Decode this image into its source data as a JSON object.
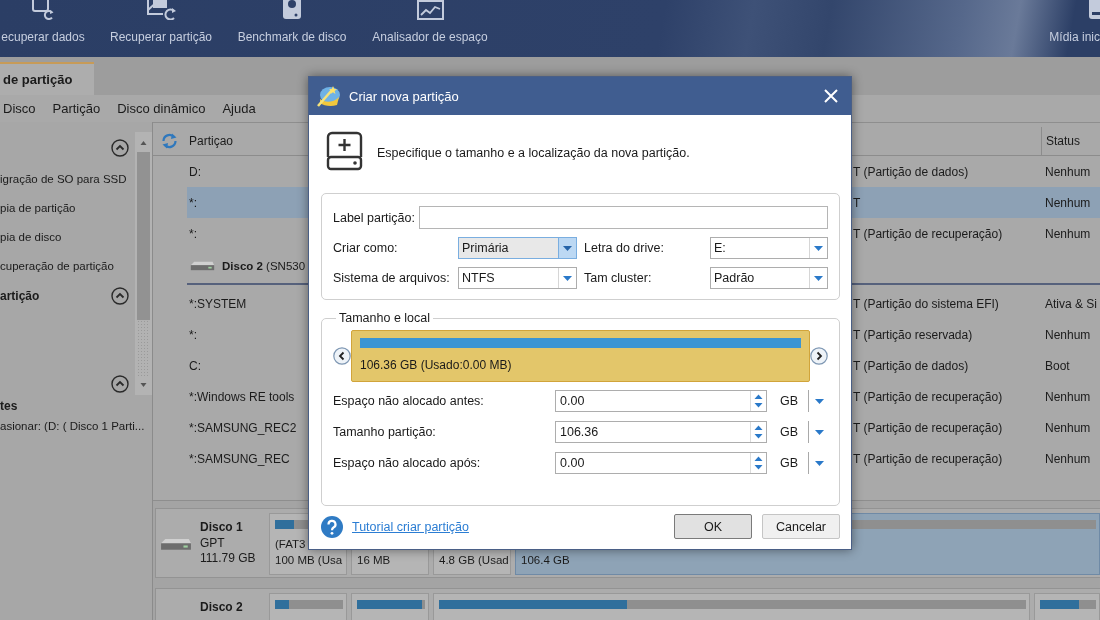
{
  "toolbar": {
    "items": [
      {
        "label": "ecuperar dados"
      },
      {
        "label": "Recuperar partição"
      },
      {
        "label": "Benchmark de disco"
      },
      {
        "label": "Analisador de espaço"
      },
      {
        "label": "Mídia inic"
      }
    ]
  },
  "tabs": [
    {
      "label": "de partição",
      "selected": true
    }
  ],
  "menu": [
    {
      "label": "Disco"
    },
    {
      "label": "Partição"
    },
    {
      "label": "Disco dinâmico"
    },
    {
      "label": "Ajuda"
    }
  ],
  "sidebar": {
    "sections": [
      {
        "expanded": true,
        "items": [
          "igração de SO para SSD",
          "pia de partição",
          "pia de disco",
          "cuperação de partição"
        ]
      },
      {
        "title": "artição",
        "expanded": true
      },
      {
        "expanded": true
      }
    ],
    "pending": {
      "title": "tes",
      "items": [
        "asionar: (D: ( Disco 1 Parti..."
      ]
    }
  },
  "table": {
    "columns": [
      {
        "label": "Partiçao"
      },
      {
        "label": "Status"
      }
    ],
    "rows": [
      {
        "kind": "partition",
        "name": "D:",
        "column_3": "T (Partição de dados)",
        "status": "Nenhum",
        "selected": false
      },
      {
        "kind": "partition",
        "name": "*:",
        "column_3": "T",
        "status": "Nenhum",
        "selected": true
      },
      {
        "kind": "partition",
        "name": "*:",
        "column_3": "T (Partição de recuperação)",
        "status": "Nenhum",
        "selected": false
      },
      {
        "kind": "disk",
        "name": "**Disco 2** (SN530",
        "selected": false
      },
      {
        "kind": "partition",
        "name": "*:SYSTEM",
        "column_3": "T (Partição do sistema EFI)",
        "status": "Ativa & Si",
        "selected": false
      },
      {
        "kind": "partition",
        "name": "*:",
        "column_3": "T (Partição reservada)",
        "status": "Nenhum",
        "selected": false
      },
      {
        "kind": "partition",
        "name": "C:",
        "column_3": "T (Partição de dados)",
        "status": "Boot",
        "selected": false
      },
      {
        "kind": "partition",
        "name": "*:Windows RE tools",
        "column_3": "T (Partição de recuperação)",
        "status": "Nenhum",
        "selected": false
      },
      {
        "kind": "partition",
        "name": "*:SAMSUNG_REC2",
        "column_3": "T (Partição de recuperação)",
        "status": "Nenhum",
        "selected": false
      },
      {
        "kind": "partition",
        "name": "*:SAMSUNG_REC",
        "column_3": "T (Partição de recuperação)",
        "status": "Nenhum",
        "selected": false
      }
    ]
  },
  "disk_map": {
    "disks": [
      {
        "name": "Disco 1",
        "scheme": "GPT",
        "size": "111.79 GB",
        "partitions": [
          {
            "file_system": "(FAT3",
            "size": "100 MB (Usa",
            "bar": true,
            "level": 0.28,
            "selected": false
          },
          {
            "size": "16 MB",
            "bar": false,
            "selected": false
          },
          {
            "size": "4.8 GB (Usad",
            "bar": false,
            "selected": false
          },
          {
            "size": "106.4 GB",
            "bar": true,
            "selected": true
          }
        ]
      },
      {
        "name": "Disco 2",
        "partitions": [
          {
            "bar": true,
            "level": 0.2,
            "selected": false
          },
          {
            "bar": true,
            "level": 0.96,
            "selected": false
          },
          {
            "bar": true,
            "level": 0.32,
            "selected": false
          },
          {
            "bar": true,
            "level": 0.7,
            "selected": false
          }
        ]
      }
    ]
  },
  "dialog": {
    "title": "Criar nova partição",
    "instruction": "Especifique o tamanho e a localização da nova partição.",
    "label_field": {
      "label": "Label partição:"
    },
    "selects": [
      {
        "label": "Criar como:",
        "value": "Primária",
        "focused": true
      },
      {
        "label": "Letra do drive:",
        "value": "E:",
        "focused": false
      },
      {
        "label": "Sistema de arquivos:",
        "value": "NTFS",
        "focused": false
      },
      {
        "label": "Tam cluster:",
        "value": "Padrão",
        "focused": false
      }
    ],
    "size_group": {
      "title": "Tamanho e local",
      "partition_caption": "106.36 GB (Usado:0.00 MB)",
      "fields": [
        {
          "label": "Espaço não alocado antes:",
          "value": "0.00",
          "unit": "GB"
        },
        {
          "label": "Tamanho partição:",
          "value": "106.36",
          "unit": "GB"
        },
        {
          "label": "Espaço não alocado após:",
          "value": "0.00",
          "unit": "GB"
        }
      ]
    },
    "help_link": "Tutorial criar partição",
    "buttons": [
      {
        "label": "OK",
        "default": true
      },
      {
        "label": "Cancelar",
        "default": false
      }
    ]
  }
}
